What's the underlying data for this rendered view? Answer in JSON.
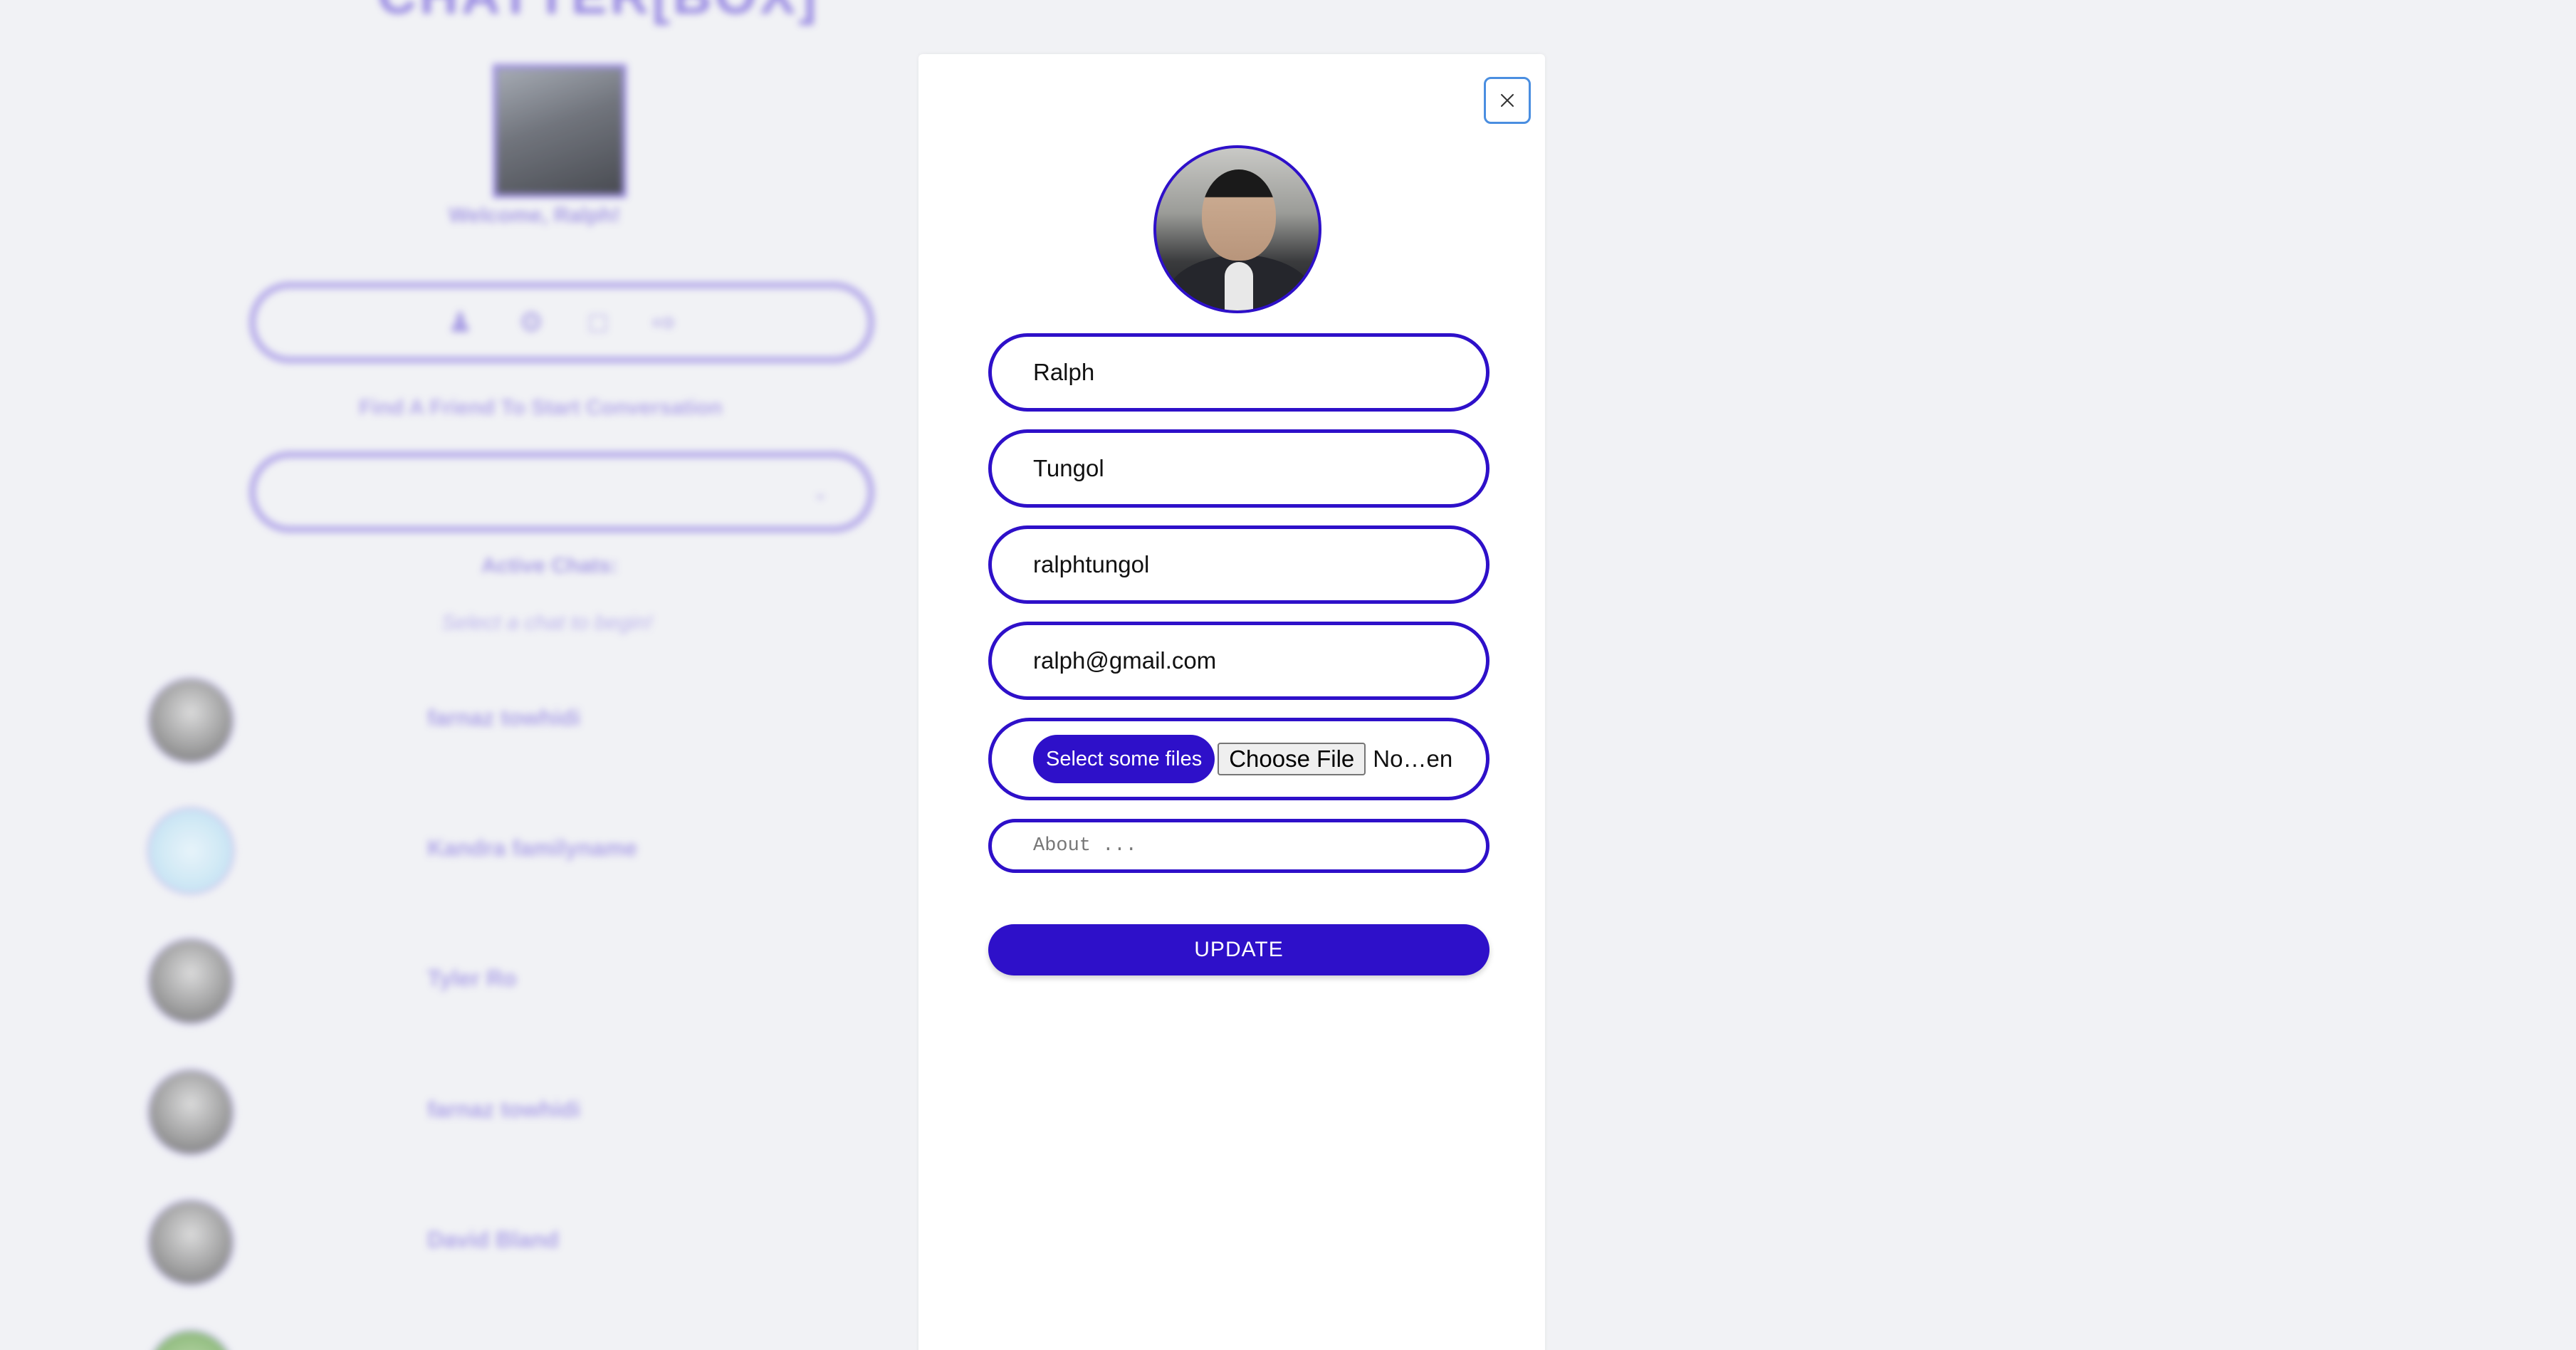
{
  "background": {
    "brand": "CHATTER[BOX]",
    "welcome_text": "Welcome, Ralph!",
    "toolbar_icons": [
      "user-icon",
      "gear-icon",
      "chat-icon",
      "logout-icon"
    ],
    "find_friend_label": "Find A Friend To Start Conversation",
    "active_chats_label": "Active Chats:",
    "select_chat_hint": "Select a chat to begin!",
    "contacts": [
      {
        "name": "farnaz towhidi",
        "avatar": "photo"
      },
      {
        "name": "Kandra familyname",
        "avatar": "react-logo"
      },
      {
        "name": "Tyler Ro",
        "avatar": "photo"
      },
      {
        "name": "farnaz towhidi",
        "avatar": "photo"
      },
      {
        "name": "David Bland",
        "avatar": "photo"
      }
    ]
  },
  "modal": {
    "close_icon": "close-icon",
    "form": {
      "first_name": "Ralph",
      "last_name": "Tungol",
      "username": "ralphtungol",
      "email": "ralph@gmail.com",
      "select_files_label": "Select some files",
      "choose_file_label": "Choose File",
      "no_file_text": "No…en",
      "about_placeholder": "About ...",
      "update_label": "UPDATE"
    }
  },
  "colors": {
    "accent": "#2e10c9",
    "page_bg": "#f1f2f5",
    "close_border": "#4a8ee0"
  }
}
